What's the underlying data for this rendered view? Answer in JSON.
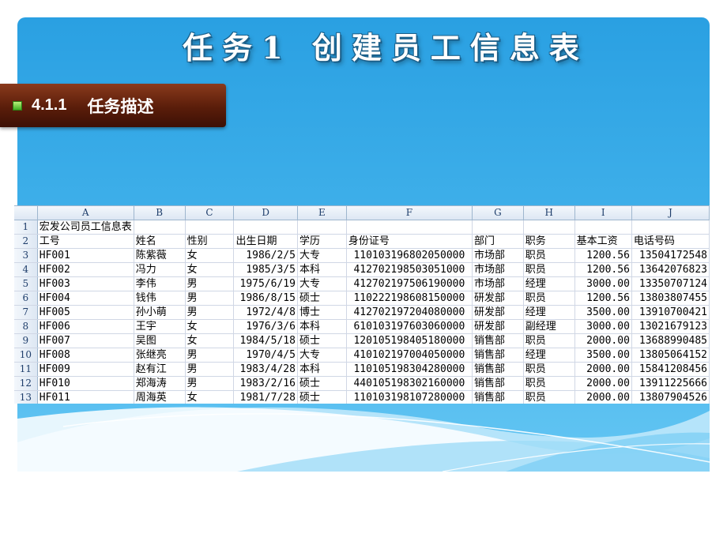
{
  "slide": {
    "title": "任务1  创建员工信息表",
    "section_number": "4.1.1",
    "section_title": "任务描述"
  },
  "sheet": {
    "columns": [
      "A",
      "B",
      "C",
      "D",
      "E",
      "F",
      "G",
      "H",
      "I",
      "J"
    ],
    "row_numbers": [
      "1",
      "2",
      "3",
      "4",
      "5",
      "6",
      "7",
      "8",
      "9",
      "10",
      "11",
      "12",
      "13"
    ],
    "title_cell": "宏发公司员工信息表",
    "headers": [
      "工号",
      "姓名",
      "性别",
      "出生日期",
      "学历",
      "身份证号",
      "部门",
      "职务",
      "基本工资",
      "电话号码"
    ],
    "rows": [
      [
        "HF001",
        "陈紫薇",
        "女",
        "1986/2/5",
        "大专",
        "110103196802050000",
        "市场部",
        "职员",
        "1200.56",
        "13504172548"
      ],
      [
        "HF002",
        "冯力",
        "女",
        "1985/3/5",
        "本科",
        "412702198503051000",
        "市场部",
        "职员",
        "1200.56",
        "13642076823"
      ],
      [
        "HF003",
        "李伟",
        "男",
        "1975/6/19",
        "大专",
        "412702197506190000",
        "市场部",
        "经理",
        "3000.00",
        "13350707124"
      ],
      [
        "HF004",
        "钱伟",
        "男",
        "1986/8/15",
        "硕士",
        "110222198608150000",
        "研发部",
        "职员",
        "1200.56",
        "13803807455"
      ],
      [
        "HF005",
        "孙小萌",
        "男",
        "1972/4/8",
        "博士",
        "412702197204080000",
        "研发部",
        "经理",
        "3500.00",
        "13910700421"
      ],
      [
        "HF006",
        "王宇",
        "女",
        "1976/3/6",
        "本科",
        "610103197603060000",
        "研发部",
        "副经理",
        "3000.00",
        "13021679123"
      ],
      [
        "HF007",
        "吴图",
        "女",
        "1984/5/18",
        "硕士",
        "120105198405180000",
        "销售部",
        "职员",
        "2000.00",
        "13688990485"
      ],
      [
        "HF008",
        "张继亮",
        "男",
        "1970/4/5",
        "大专",
        "410102197004050000",
        "销售部",
        "经理",
        "3500.00",
        "13805064152"
      ],
      [
        "HF009",
        "赵有江",
        "男",
        "1983/4/28",
        "本科",
        "110105198304280000",
        "销售部",
        "职员",
        "2000.00",
        "15841208456"
      ],
      [
        "HF010",
        "郑海涛",
        "男",
        "1983/2/16",
        "硕士",
        "440105198302160000",
        "销售部",
        "职员",
        "2000.00",
        "13911225666"
      ],
      [
        "HF011",
        "周海英",
        "女",
        "1981/7/28",
        "硕士",
        "110103198107280000",
        "销售部",
        "职员",
        "2000.00",
        "13807904526"
      ]
    ]
  }
}
